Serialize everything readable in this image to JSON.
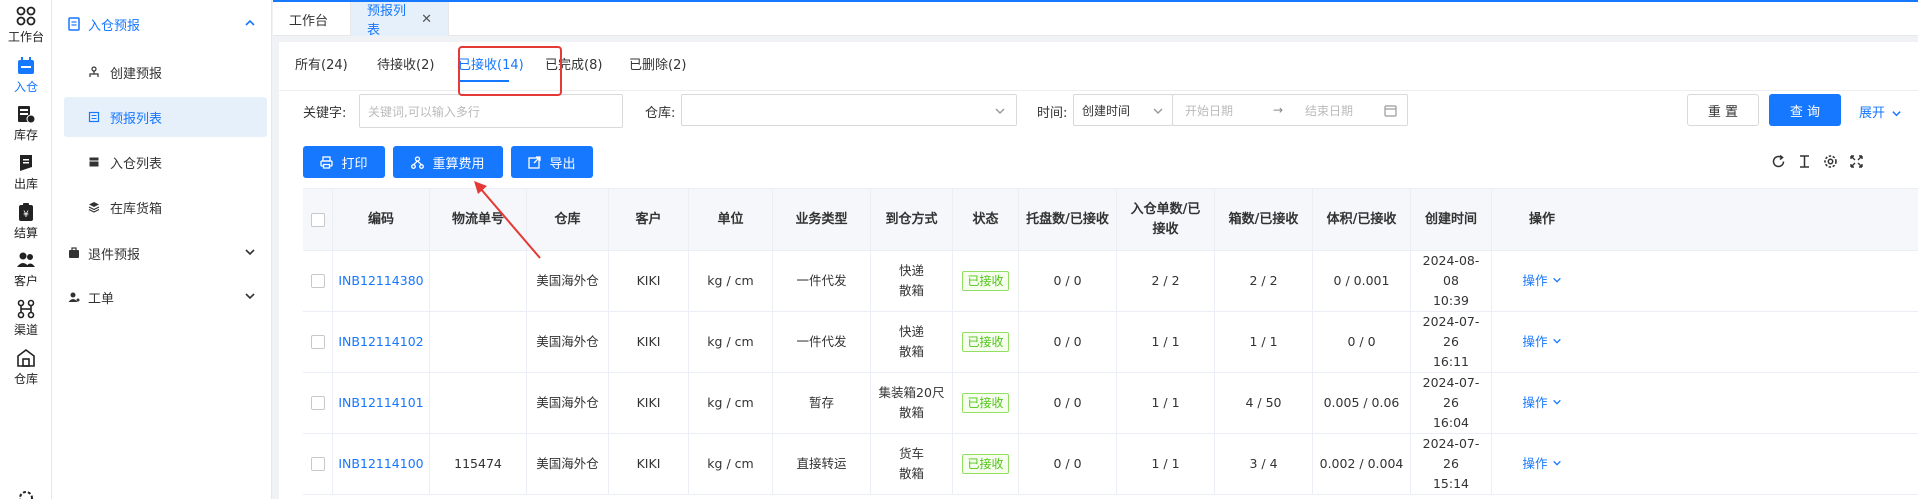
{
  "rail": [
    {
      "label": "工作台",
      "icon": "workbench-icon",
      "active": false
    },
    {
      "label": "入仓",
      "icon": "inbound-icon",
      "active": true
    },
    {
      "label": "库存",
      "icon": "inventory-icon",
      "active": false
    },
    {
      "label": "出库",
      "icon": "outbound-icon",
      "active": false
    },
    {
      "label": "结算",
      "icon": "settlement-icon",
      "active": false
    },
    {
      "label": "客户",
      "icon": "customer-icon",
      "active": false
    },
    {
      "label": "渠道",
      "icon": "channel-icon",
      "active": false
    },
    {
      "label": "仓库",
      "icon": "warehouse-icon",
      "active": false
    }
  ],
  "subnav": {
    "group_inbound": "入仓预报",
    "items": [
      "创建预报",
      "预报列表",
      "入仓列表",
      "在库货箱"
    ],
    "group_return": "退件预报",
    "group_ticket": "工单"
  },
  "tabs": {
    "workbench": "工作台",
    "forecast_list": "预报列表"
  },
  "status_tabs": [
    "所有(24)",
    "待接收(2)",
    "已接收(14)",
    "已完成(8)",
    "已删除(2)"
  ],
  "filters": {
    "keyword_label": "关键字:",
    "keyword_placeholder": "关键词,可以输入多行",
    "warehouse_label": "仓库:",
    "time_label": "时间:",
    "time_type": "创建时间",
    "start_date": "开始日期",
    "end_date": "结束日期",
    "range_arrow": "→",
    "reset": "重 置",
    "query": "查 询",
    "expand": "展开"
  },
  "actions": {
    "print": "打印",
    "recalc": "重算费用",
    "export": "导出"
  },
  "table": {
    "headers": [
      "编码",
      "物流单号",
      "仓库",
      "客户",
      "单位",
      "业务类型",
      "到仓方式",
      "状态",
      "托盘数/已接收",
      "入仓单数/已接收",
      "箱数/已接收",
      "体积/已接收",
      "创建时间",
      "操作"
    ],
    "rows": [
      {
        "code": "INB12114380",
        "tracking": "",
        "warehouse": "美国海外仓",
        "customer": "KIKI",
        "unit": "kg / cm",
        "biz": "一件代发",
        "arrival1": "快递",
        "arrival2": "散箱",
        "status": "已接收",
        "pallets": "0 / 0",
        "orders": "2 / 2",
        "boxes": "2 / 2",
        "volume": "0 / 0.001",
        "date": "2024-08-08",
        "time": "10:39",
        "op": "操作"
      },
      {
        "code": "INB12114102",
        "tracking": "",
        "warehouse": "美国海外仓",
        "customer": "KIKI",
        "unit": "kg / cm",
        "biz": "一件代发",
        "arrival1": "快递",
        "arrival2": "散箱",
        "status": "已接收",
        "pallets": "0 / 0",
        "orders": "1 / 1",
        "boxes": "1 / 1",
        "volume": "0 / 0",
        "date": "2024-07-26",
        "time": "16:11",
        "op": "操作"
      },
      {
        "code": "INB12114101",
        "tracking": "",
        "warehouse": "美国海外仓",
        "customer": "KIKI",
        "unit": "kg / cm",
        "biz": "暂存",
        "arrival1": "集装箱20尺",
        "arrival2": "散箱",
        "status": "已接收",
        "pallets": "0 / 0",
        "orders": "1 / 1",
        "boxes": "4 / 50",
        "volume": "0.005 / 0.06",
        "date": "2024-07-26",
        "time": "16:04",
        "op": "操作"
      },
      {
        "code": "INB12114100",
        "tracking": "115474",
        "warehouse": "美国海外仓",
        "customer": "KIKI",
        "unit": "kg / cm",
        "biz": "直接转运",
        "arrival1": "货车",
        "arrival2": "散箱",
        "status": "已接收",
        "pallets": "0 / 0",
        "orders": "1 / 1",
        "boxes": "3 / 4",
        "volume": "0.002 / 0.004",
        "date": "2024-07-26",
        "time": "15:14",
        "op": "操作"
      }
    ]
  },
  "colors": {
    "accent": "#1677ff",
    "highlight": "#e53935",
    "status_green": "#52c41a"
  }
}
